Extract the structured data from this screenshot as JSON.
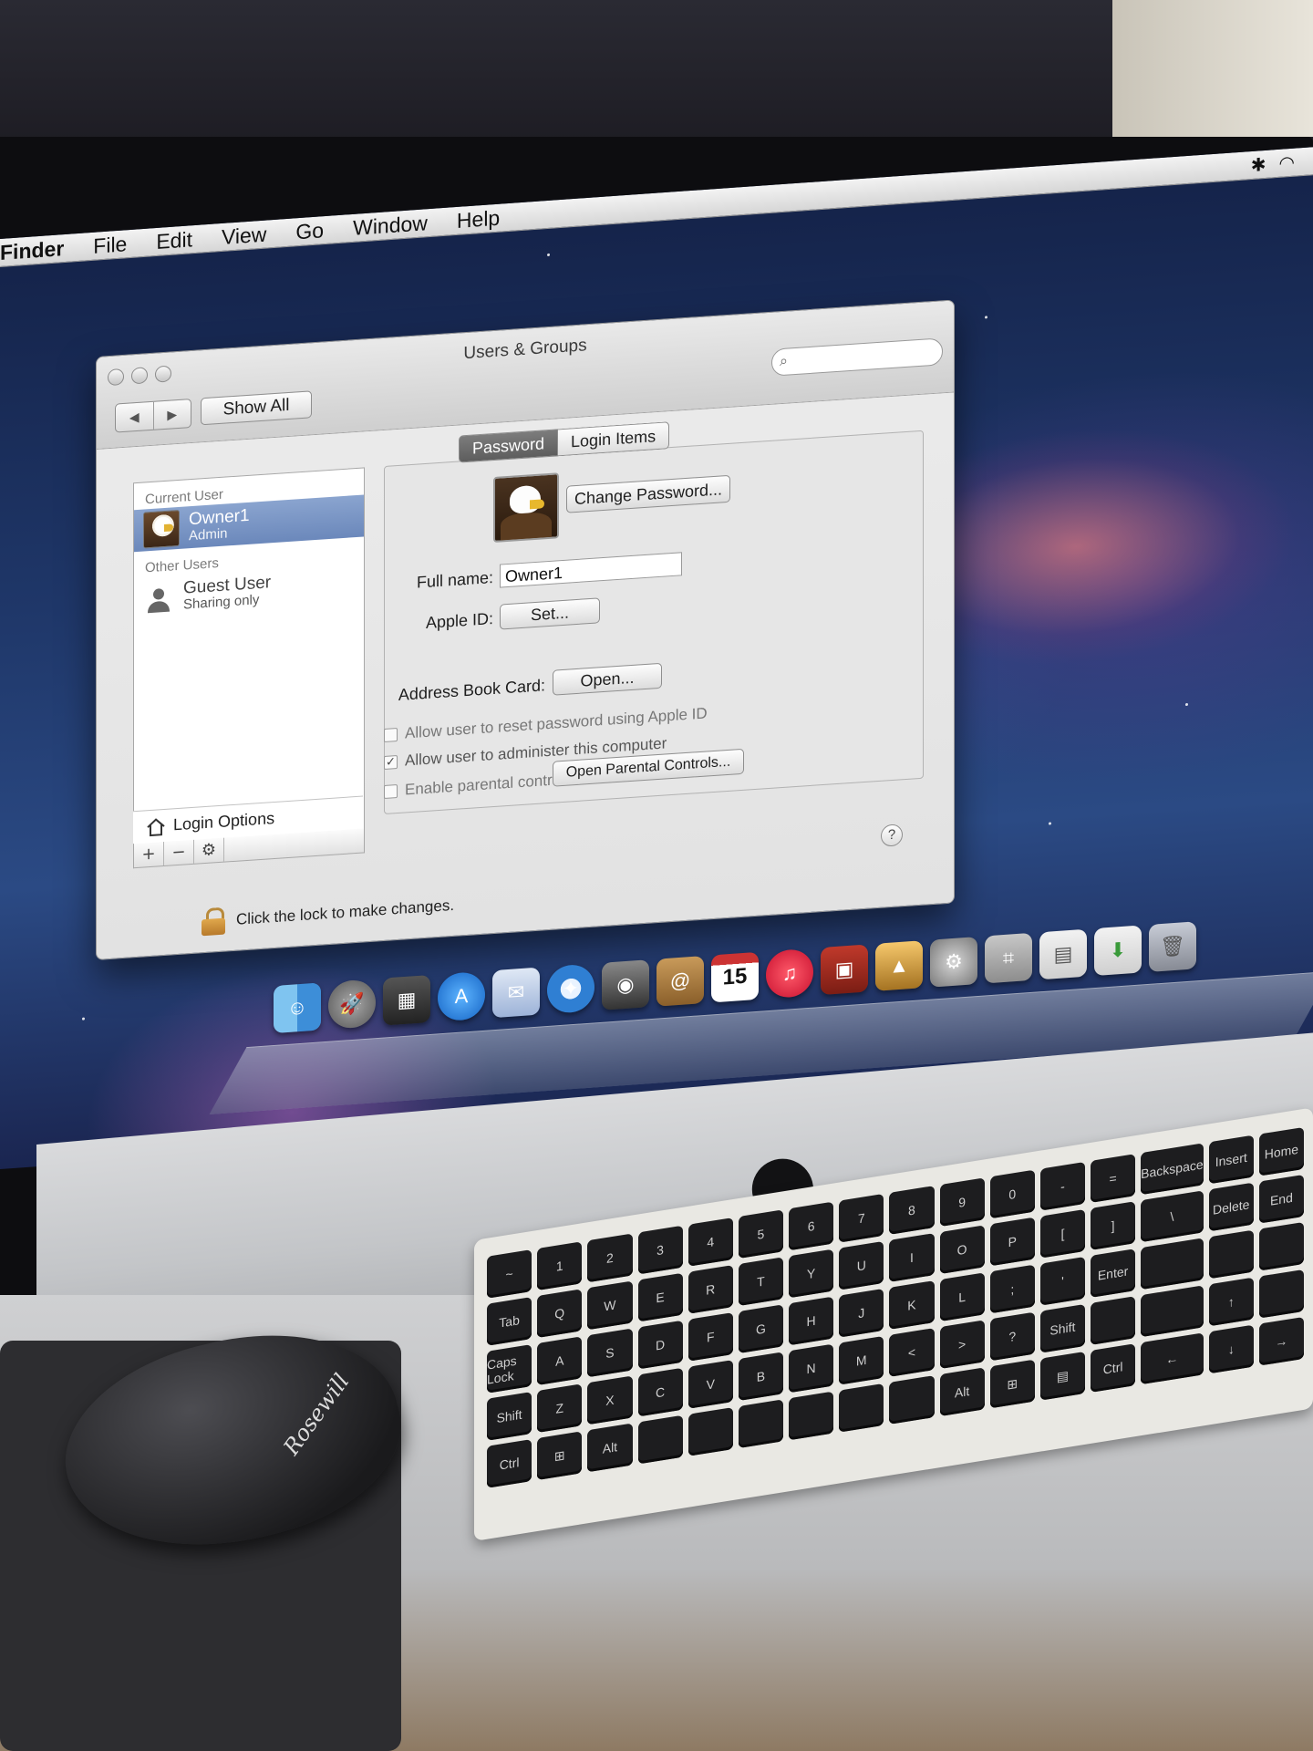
{
  "menubar": {
    "app": "Finder",
    "items": [
      "File",
      "Edit",
      "View",
      "Go",
      "Window",
      "Help"
    ],
    "status": [
      "bluetooth-icon",
      "wifi-icon"
    ]
  },
  "window": {
    "title": "Users & Groups",
    "show_all": "Show All",
    "search_placeholder": "",
    "nav_back": "◀",
    "nav_forward": "▶"
  },
  "sidebar": {
    "current_user_header": "Current User",
    "other_users_header": "Other Users",
    "users": [
      {
        "name": "Owner1",
        "role": "Admin"
      },
      {
        "name": "Guest User",
        "role": "Sharing only"
      }
    ],
    "login_options": "Login Options",
    "buttons": [
      "+",
      "−",
      "⚙"
    ]
  },
  "tabs": [
    "Password",
    "Login Items"
  ],
  "panel": {
    "change_password": "Change Password...",
    "full_name_label": "Full name:",
    "full_name_value": "Owner1",
    "apple_id_label": "Apple ID:",
    "apple_id_button": "Set...",
    "address_book_label": "Address Book Card:",
    "address_book_button": "Open...",
    "checkboxes": [
      {
        "label": "Allow user to reset password using Apple ID",
        "checked": false
      },
      {
        "label": "Allow user to administer this computer",
        "checked": true
      },
      {
        "label": "Enable parental controls",
        "checked": false
      }
    ],
    "parental_button": "Open Parental Controls...",
    "help": "?"
  },
  "lock_text": "Click the lock to make changes.",
  "dock": {
    "calendar_day": "15",
    "icons": [
      "finder-icon",
      "launchpad-icon",
      "mission-control-icon",
      "app-store-icon",
      "mail-icon",
      "safari-icon",
      "facetime-icon",
      "address-book-icon",
      "calendar-icon",
      "itunes-icon",
      "photo-booth-icon",
      "iphoto-icon",
      "system-preferences-icon",
      "preview-icon",
      "documents-icon",
      "downloads-icon",
      "trash-icon"
    ]
  },
  "keyboard": {
    "rows": [
      [
        "~",
        "1",
        "2",
        "3",
        "4",
        "5",
        "6",
        "7",
        "8",
        "9",
        "0",
        "-",
        "=",
        "Backspace",
        "Insert",
        "Home"
      ],
      [
        "Tab",
        "Q",
        "W",
        "E",
        "R",
        "T",
        "Y",
        "U",
        "I",
        "O",
        "P",
        "[",
        "]",
        "\\",
        "Delete",
        "End"
      ],
      [
        "Caps Lock",
        "A",
        "S",
        "D",
        "F",
        "G",
        "H",
        "J",
        "K",
        "L",
        ";",
        "'",
        "Enter",
        "",
        "",
        ""
      ],
      [
        "Shift",
        "Z",
        "X",
        "C",
        "V",
        "B",
        "N",
        "M",
        "<",
        ">",
        "?",
        "Shift",
        "",
        "",
        "↑",
        ""
      ],
      [
        "Ctrl",
        "⊞",
        "Alt",
        "",
        "",
        "",
        "",
        "",
        "",
        "Alt",
        "⊞",
        "▤",
        "Ctrl",
        "←",
        "↓",
        "→"
      ]
    ]
  },
  "mouse_brand": "Rosewill",
  "colors": {
    "selection": "#7a95c4",
    "tab_active": "#6e6e6e",
    "desktop": "#1f3769"
  }
}
